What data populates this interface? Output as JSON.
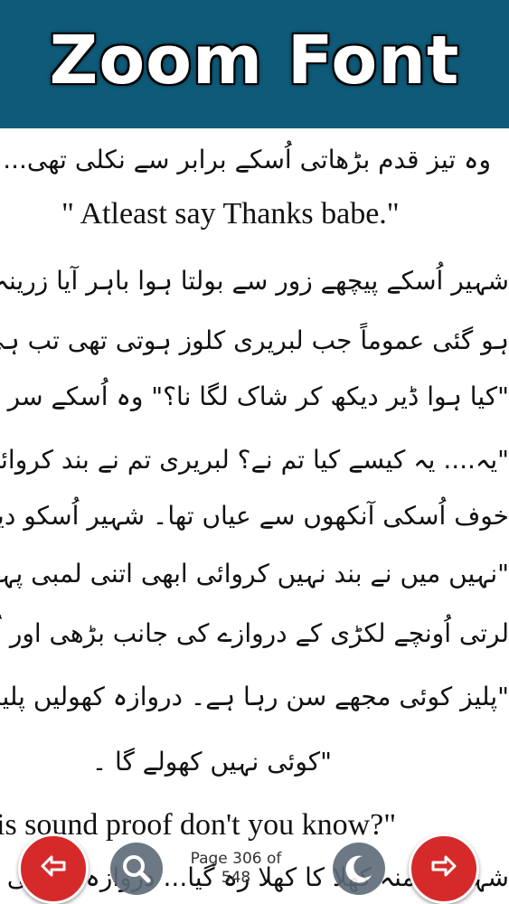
{
  "header": {
    "title": "Zoom Font"
  },
  "content": {
    "lines": [
      "وہ تیز قدم بڑھاتی اُسکے برابر سے نکلی تھی...",
      "\" Atleast say Thanks babe.\"",
      "شہیر اُسکے پیچھے زور سے بولتا ہوا باہر آیا زرینہ جو گیٹ کے پ",
      "ہو گئی عموماً جب لبریری کلوز ہوتی تھی تب ہی یہ گیٹ بند کیا",
      "\"کیا ہوا ڈیر دیکھ کر شاک لگا نا؟\" وہ اُسکے سر پر پہنچ کر جھکتا ہو",
      "\"یہ.... یہ کیسے کیا تم نے؟ لبریری تم نے بند کروائی ہے نہ",
      "خوف اُسکی آنکھوں سے عیاں تھا۔ شہیر اُسکو دیکھتا مکروانداز",
      "\"نہیں میں نے بند نہیں کروائی ابھی اتنی لمبی پہنچ نہیں ہوئی",
      "لرتی اُونچے لکڑی کے دروازے کی جانب بڑھی اور اُسکو زور",
      "\"پلیز کوئی مجھے سن رہا ہے۔ دروازہ کھولیں پلیز۔ ہیلپ\"  r",
      "\"کوئی نہیں کھولے گا ۔",
      "is sound proof don't you know?\"",
      "شہیر کا منہ کھلا کا کھلا رہ گیا... دروازہ اُڑا ہی"
    ]
  },
  "footer": {
    "page_text": "Page 306 of",
    "page_total": "548"
  }
}
